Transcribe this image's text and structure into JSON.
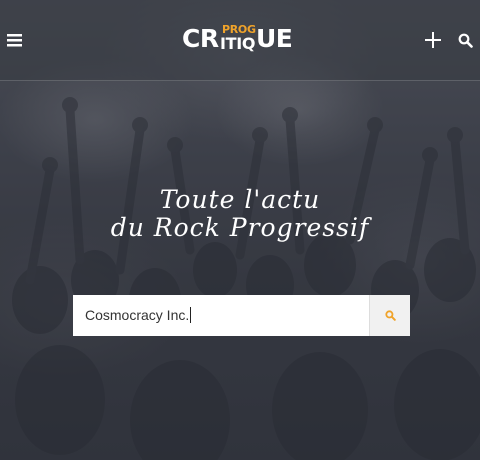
{
  "header": {
    "logo": {
      "part_cr": "CR",
      "part_prog": "PROG",
      "part_itiq": "ITIQ",
      "part_ue": "UE",
      "accent_color": "#f0a32a"
    },
    "icons": {
      "menu": "hamburger-menu-icon",
      "add": "plus-icon",
      "search": "search-icon"
    }
  },
  "hero": {
    "tagline_line1": "Toute l'actu",
    "tagline_line2": "du Rock Progressif"
  },
  "search": {
    "value": "Cosmocracy Inc.",
    "submit_icon": "search-icon",
    "submit_icon_color": "#f0a32a"
  }
}
